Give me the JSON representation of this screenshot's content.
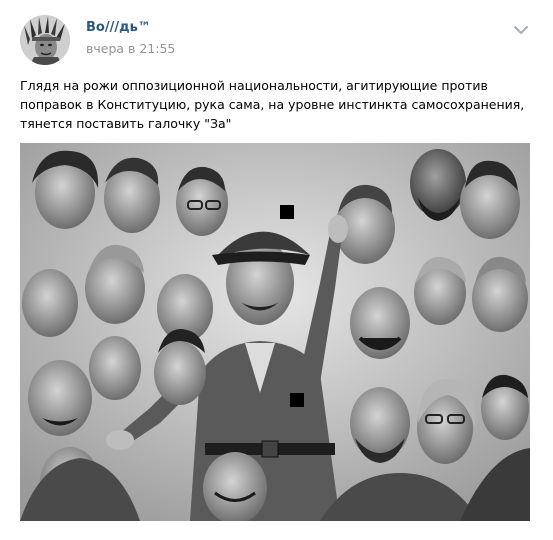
{
  "post": {
    "author_name": "Во///дь™",
    "date": "вчера в 21:55",
    "text": "Глядя на рожи оппозиционной национальности, агитирующие против поправок в Конституцию, рука сама, на уровне инстинкта самосохранения, тянется поставить галочку \"За\"",
    "menu_icon": "chevron-down-icon",
    "avatar_icon": "avatar-portrait-icon"
  },
  "photo": {
    "description_icon": "caricature-collage-image"
  },
  "colors": {
    "author_link": "#2a5885",
    "date_gray": "#939393",
    "menu_gray": "#a3adba"
  }
}
